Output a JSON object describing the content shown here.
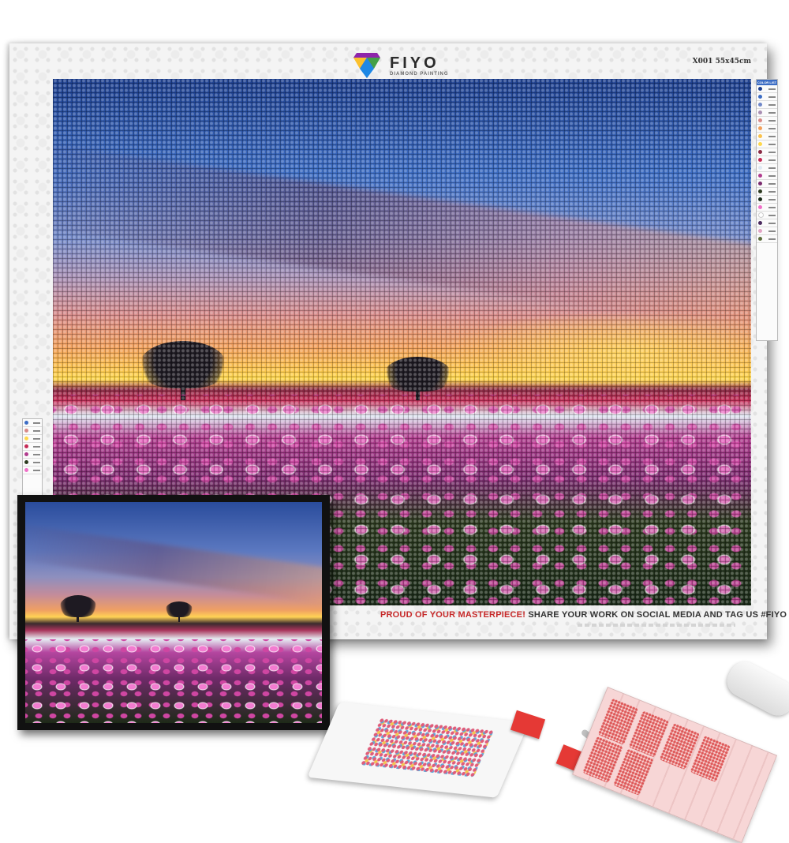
{
  "brand": {
    "name": "FIYO",
    "subtitle": "DIAMOND PAINTING"
  },
  "size_code": "X001 55x45cm",
  "legend_title": "COLOR LIST",
  "footer": {
    "highlight": "PROUD OF YOUR MASTERPIECE!",
    "message": "SHARE YOUR WORK ON SOCIAL MEDIA AND TAG US #FIYO"
  },
  "colors": {
    "accent_red": "#c62828",
    "sky_blue": "#3b6cc4",
    "sunset_yellow": "#ffd84a",
    "tulip_pink": "#d64aa8"
  }
}
